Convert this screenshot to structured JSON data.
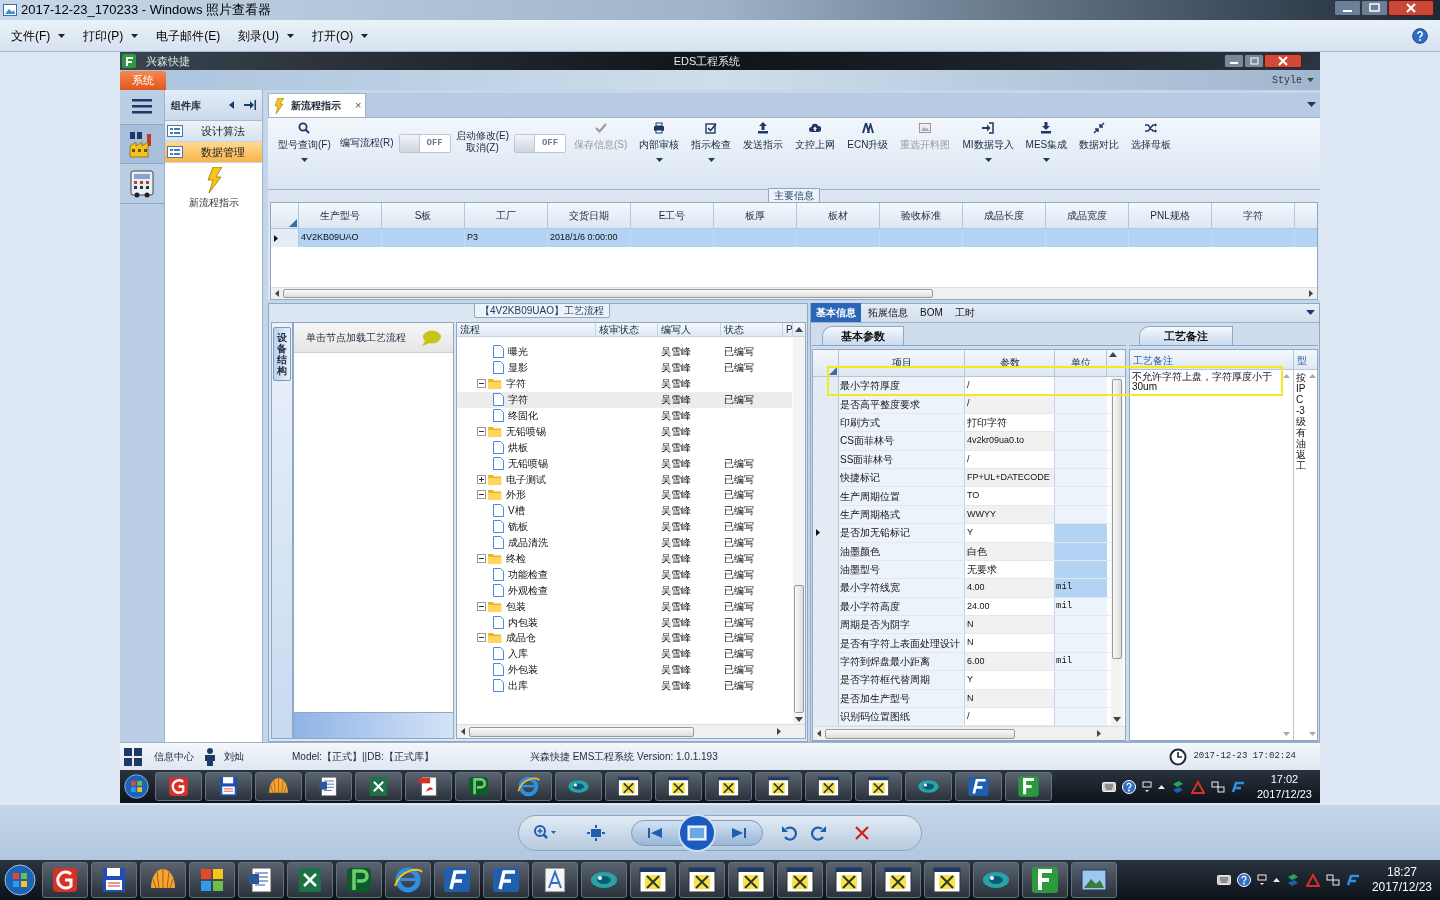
{
  "viewer": {
    "title": "2017-12-23_170233 - Windows 照片查看器"
  },
  "menu": [
    {
      "label": "文件(F)",
      "dropdown": true
    },
    {
      "label": "打印(P)",
      "dropdown": true
    },
    {
      "label": "电子邮件(E)",
      "dropdown": false
    },
    {
      "label": "刻录(U)",
      "dropdown": true
    },
    {
      "label": "打开(O)",
      "dropdown": true
    }
  ],
  "app": {
    "quick_access": "兴森快捷",
    "title": "EDS工程系统",
    "ribbon_tab": "系统",
    "style_menu": "Style"
  },
  "sidebar": {
    "title": "组件库",
    "items": [
      {
        "label": "设计算法",
        "selected": false
      },
      {
        "label": "数据管理",
        "selected": true
      }
    ],
    "shortcut": "新流程指示"
  },
  "doc_tab": {
    "label": "新流程指示",
    "close": "×"
  },
  "toolbar": [
    {
      "kind": "button",
      "label": "型号查询(F)",
      "dropdown": true,
      "disabled": false
    },
    {
      "kind": "label",
      "label": "编写流程(R)"
    },
    {
      "kind": "toggle",
      "label": "OFF",
      "on": false
    },
    {
      "kind": "label",
      "label": "启动修改(E)\n取消(Z)"
    },
    {
      "kind": "toggle",
      "label": "OFF",
      "on": false
    },
    {
      "kind": "button",
      "label": "保存信息(S)",
      "dropdown": false,
      "disabled": true
    },
    {
      "kind": "button",
      "label": "内部审核",
      "dropdown": true,
      "disabled": false
    },
    {
      "kind": "button",
      "label": "指示检查",
      "dropdown": true,
      "disabled": false
    },
    {
      "kind": "button",
      "label": "发送指示",
      "dropdown": false,
      "disabled": false
    },
    {
      "kind": "button",
      "label": "文控上网",
      "dropdown": false,
      "disabled": false
    },
    {
      "kind": "button",
      "label": "ECN升级",
      "dropdown": false,
      "disabled": false
    },
    {
      "kind": "button",
      "label": "重选开料图",
      "dropdown": false,
      "disabled": true
    },
    {
      "kind": "button",
      "label": "MI数据导入",
      "dropdown": true,
      "disabled": false
    },
    {
      "kind": "button",
      "label": "MES集成",
      "dropdown": true,
      "disabled": false
    },
    {
      "kind": "button",
      "label": "数据对比",
      "dropdown": false,
      "disabled": false
    },
    {
      "kind": "button",
      "label": "选择母板",
      "dropdown": false,
      "disabled": false
    }
  ],
  "main_info": {
    "title": "主要信息",
    "columns": [
      "生产型号",
      "S板",
      "工厂",
      "交货日期",
      "E工号",
      "板厚",
      "板材",
      "验收标准",
      "成品长度",
      "成品宽度",
      "PNL规格",
      "字符"
    ],
    "rows": [
      {
        "selected": true,
        "cells": [
          "4V2KB09UAO",
          null,
          "P3",
          "2018/1/6 0:00:00",
          null,
          null,
          null,
          null,
          null,
          null,
          null,
          null
        ]
      }
    ]
  },
  "process": {
    "title": "【4V2KB09UAO】工艺流程",
    "side_tab": "设备结构",
    "hint": "单击节点加载工艺流程",
    "columns": [
      "流程",
      "核审状态",
      "编写人",
      "状态",
      "P"
    ],
    "nodes": [
      {
        "children": [
          {
            "kind": "file",
            "label": "曝光",
            "author": "吴雪峰",
            "status": "已编写",
            "selected": false
          },
          {
            "kind": "file",
            "label": "显影",
            "author": "吴雪峰",
            "status": "已编写",
            "selected": false
          }
        ]
      },
      {
        "kind": "folder",
        "label": "字符",
        "author": "吴雪峰",
        "expanded": true,
        "selected": false,
        "children": [
          {
            "kind": "file",
            "label": "字符",
            "author": "吴雪峰",
            "status": "已编写",
            "selected": true
          },
          {
            "kind": "file",
            "label": "终固化",
            "author": "吴雪峰",
            "selected": false
          }
        ]
      },
      {
        "kind": "folder",
        "label": "无铅喷锡",
        "author": "吴雪峰",
        "expanded": true,
        "selected": false,
        "children": [
          {
            "kind": "file",
            "label": "烘板",
            "author": "吴雪峰",
            "selected": false
          },
          {
            "kind": "file",
            "label": "无铅喷锡",
            "author": "吴雪峰",
            "status": "已编写",
            "selected": false
          }
        ]
      },
      {
        "kind": "folder",
        "label": "电子测试",
        "author": "吴雪峰",
        "status": "已编写",
        "expanded": false,
        "selected": false
      },
      {
        "kind": "folder",
        "label": "外形",
        "author": "吴雪峰",
        "status": "已编写",
        "expanded": true,
        "selected": false,
        "children": [
          {
            "kind": "file",
            "label": "V槽",
            "author": "吴雪峰",
            "status": "已编写",
            "selected": false
          },
          {
            "kind": "file",
            "label": "铣板",
            "author": "吴雪峰",
            "status": "已编写",
            "selected": false
          },
          {
            "kind": "file",
            "label": "成品清洗",
            "author": "吴雪峰",
            "status": "已编写",
            "selected": false
          }
        ]
      },
      {
        "kind": "folder",
        "label": "终检",
        "author": "吴雪峰",
        "status": "已编写",
        "expanded": true,
        "selected": false,
        "children": [
          {
            "kind": "file",
            "label": "功能检查",
            "author": "吴雪峰",
            "status": "已编写",
            "selected": false
          },
          {
            "kind": "file",
            "label": "外观检查",
            "author": "吴雪峰",
            "status": "已编写",
            "selected": false
          }
        ]
      },
      {
        "kind": "folder",
        "label": "包装",
        "author": "吴雪峰",
        "status": "已编写",
        "expanded": true,
        "selected": false,
        "children": [
          {
            "kind": "file",
            "label": "内包装",
            "author": "吴雪峰",
            "status": "已编写",
            "selected": false
          }
        ]
      },
      {
        "kind": "folder",
        "label": "成品仓",
        "author": "吴雪峰",
        "status": "已编写",
        "expanded": true,
        "selected": false,
        "children": [
          {
            "kind": "file",
            "label": "入库",
            "author": "吴雪峰",
            "status": "已编写",
            "selected": false
          },
          {
            "kind": "file",
            "label": "外包装",
            "author": "吴雪峰",
            "status": "已编写",
            "selected": false
          },
          {
            "kind": "file",
            "label": "出库",
            "author": "吴雪峰",
            "status": "已编写",
            "selected": false
          }
        ]
      }
    ]
  },
  "params": {
    "tabs": [
      {
        "label": "基本信息",
        "selected": true
      },
      {
        "label": "拓展信息",
        "selected": false
      },
      {
        "label": "BOM",
        "selected": false
      },
      {
        "label": "工时",
        "selected": false
      }
    ],
    "subtab": "基本参数",
    "columns": [
      "项目",
      "参数",
      "单位"
    ],
    "rows": [
      {
        "item": "最小字符厚度",
        "value": "/",
        "current": false,
        "unit_selected": false
      },
      {
        "item": "是否高平整度要求",
        "value": "/",
        "current": false,
        "unit_selected": false
      },
      {
        "item": "印刷方式",
        "value": "打印字符",
        "current": false,
        "unit_selected": false
      },
      {
        "item": "CS面菲林号",
        "value": "4v2kr09ua0.to",
        "current": false,
        "unit_selected": false
      },
      {
        "item": "SS面菲林号",
        "value": "/",
        "current": false,
        "unit_selected": false
      },
      {
        "item": "快捷标记",
        "value": "FP+UL+DATECODE",
        "current": false,
        "unit_selected": false
      },
      {
        "item": "生产周期位置",
        "value": "TO",
        "current": false,
        "unit_selected": false
      },
      {
        "item": "生产周期格式",
        "value": "WWYY",
        "current": false,
        "unit_selected": false
      },
      {
        "item": "是否加无铅标记",
        "value": "Y",
        "current": true,
        "unit_selected": true
      },
      {
        "item": "油墨颜色",
        "value": "白色",
        "current": false,
        "unit_selected": true
      },
      {
        "item": "油墨型号",
        "value": "无要求",
        "current": false,
        "unit_selected": true
      },
      {
        "item": "最小字符线宽",
        "value": "4.00",
        "unit": "mil",
        "current": false,
        "unit_selected": true
      },
      {
        "item": "最小字符高度",
        "value": "24.00",
        "unit": "mil",
        "current": false,
        "unit_selected": false
      },
      {
        "item": "周期是否为阴字",
        "value": "N",
        "current": false,
        "unit_selected": false
      },
      {
        "item": "是否有字符上表面处理设计",
        "value": "N",
        "current": false,
        "unit_selected": false
      },
      {
        "item": "字符到焊盘最小距离",
        "value": "6.00",
        "unit": "mil",
        "current": false,
        "unit_selected": false
      },
      {
        "item": "是否字符框代替周期",
        "value": "Y",
        "current": false,
        "unit_selected": false
      },
      {
        "item": "是否加生产型号",
        "value": "N",
        "current": false,
        "unit_selected": false
      },
      {
        "item": "识别码位置图纸",
        "value": "/",
        "current": false,
        "unit_selected": false
      }
    ]
  },
  "notes": {
    "tab": "工艺备注",
    "columns": [
      "工艺备注",
      "型"
    ],
    "text": "不允许字符上盘，字符厚度小于30um",
    "column_2_text": "按IPC-3级有油返工"
  },
  "status_bar": {
    "info_center": "信息中心",
    "user": "刘灿",
    "model": "Model:【正式】||DB:【正式库】",
    "version": "兴森快捷 EMS工程系统 Version: 1.0.1.193",
    "time": "2017-12-23 17:02:24"
  },
  "inner_taskbar": {
    "time": "17:02",
    "date": "2017/12/23"
  },
  "taskbar": {
    "time": "18:27",
    "date": "2017/12/23"
  }
}
